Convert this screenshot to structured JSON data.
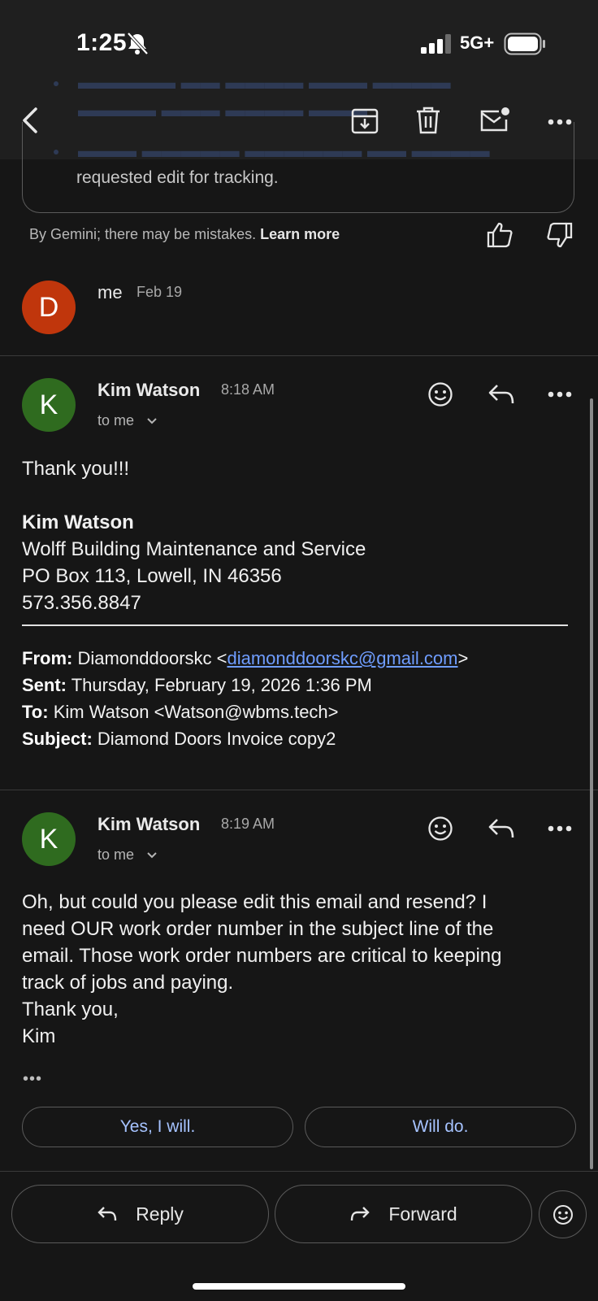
{
  "status_bar": {
    "time": "1:25",
    "network": "5G+"
  },
  "summary": {
    "visible_text": "requested edit for tracking.",
    "disclaimer": "By Gemini; there may be mistakes.",
    "learn_more": "Learn more"
  },
  "thread": [
    {
      "avatar_letter": "D",
      "sender": "me",
      "date": "Feb 19",
      "avatar_color": "#c0360c"
    },
    {
      "avatar_letter": "K",
      "sender": "Kim Watson",
      "time": "8:18 AM",
      "recipient": "to me",
      "avatar_color": "#2f6b1f",
      "body_greeting": "Thank you!!!",
      "signature": {
        "name": "Kim Watson",
        "company": "Wolff Building Maintenance and Service",
        "address": "PO Box 113, Lowell, IN 46356",
        "phone": "573.356.8847"
      },
      "quoted": {
        "from_label": "From:",
        "from_name": " Diamonddoorskc <",
        "from_email": "diamonddoorskc@gmail.com",
        "from_close": ">",
        "sent_label": "Sent:",
        "sent_value": " Thursday, February 19, 2026 1:36 PM",
        "to_label": "To:",
        "to_value": " Kim Watson <Watson@wbms.tech>",
        "subject_label": "Subject:",
        "subject_value": " Diamond Doors Invoice copy2"
      }
    },
    {
      "avatar_letter": "K",
      "sender": "Kim Watson",
      "time": "8:19 AM",
      "recipient": "to me",
      "avatar_color": "#2f6b1f",
      "body_lines": [
        "Oh, but could you please edit this email and resend? I",
        "need OUR work order number in the subject line of the",
        "email. Those work order numbers are critical to keeping",
        "track of jobs and paying.",
        "Thank you,",
        "Kim"
      ],
      "trimmed": "•••"
    }
  ],
  "smart_replies": [
    "Yes, I will.",
    "Will do."
  ],
  "actions": {
    "reply": "Reply",
    "forward": "Forward"
  },
  "colors": {
    "accent": "#a6c3ff",
    "link": "#6f9dff",
    "background": "#161616"
  }
}
